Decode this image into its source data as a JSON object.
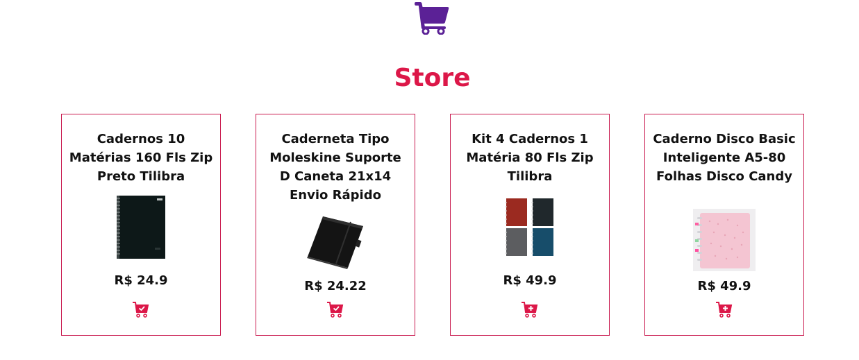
{
  "header": {
    "logo_icon": "shopping-cart-icon",
    "logo_color": "#5b2196",
    "title": "Store",
    "title_color": "#dc1748"
  },
  "products": [
    {
      "name": "Cadernos 10 Matérias 160 Fls Zip Preto Tilibra",
      "price": "R$ 24.9",
      "cart_icon": "cart-check-icon",
      "image": "black-spiral-notebook"
    },
    {
      "name": "Caderneta Tipo Moleskine Suporte D Caneta 21x14 Envio Rápido",
      "price": "R$ 24.22",
      "cart_icon": "cart-check-icon",
      "image": "black-moleskine-notebook"
    },
    {
      "name": "Kit 4 Cadernos 1 Matéria 80 Fls Zip Tilibra",
      "price": "R$ 49.9",
      "cart_icon": "cart-plus-icon",
      "image": "four-colored-notebooks"
    },
    {
      "name": "Caderno Disco Basic Inteligente A5-80 Folhas Disco Candy",
      "price": "R$ 49.9",
      "cart_icon": "cart-plus-icon",
      "image": "pink-disc-notebook"
    }
  ],
  "colors": {
    "accent": "#dc1748",
    "card_border": "#c91a4f",
    "cart_button": "#dc1748"
  }
}
